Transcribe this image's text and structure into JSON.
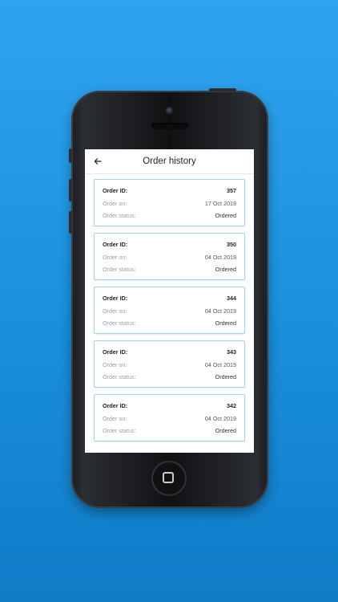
{
  "app": {
    "title": "Order history",
    "back_icon": "arrow-left-icon"
  },
  "labels": {
    "order_id": "Order ID:",
    "order_on": "Order on:",
    "order_status": "Order status:"
  },
  "orders": [
    {
      "id": "357",
      "date": "17 Oct 2019",
      "status": "Ordered"
    },
    {
      "id": "350",
      "date": "04 Oct 2019",
      "status": "Ordered"
    },
    {
      "id": "344",
      "date": "04 Oct 2019",
      "status": "Ordered"
    },
    {
      "id": "343",
      "date": "04 Oct 2019",
      "status": "Ordered"
    },
    {
      "id": "342",
      "date": "04 Oct 2019",
      "status": "Ordered"
    }
  ],
  "colors": {
    "background": "#1f95e3",
    "card_border": "#9ed4ee",
    "phone_body": "#16181b"
  }
}
